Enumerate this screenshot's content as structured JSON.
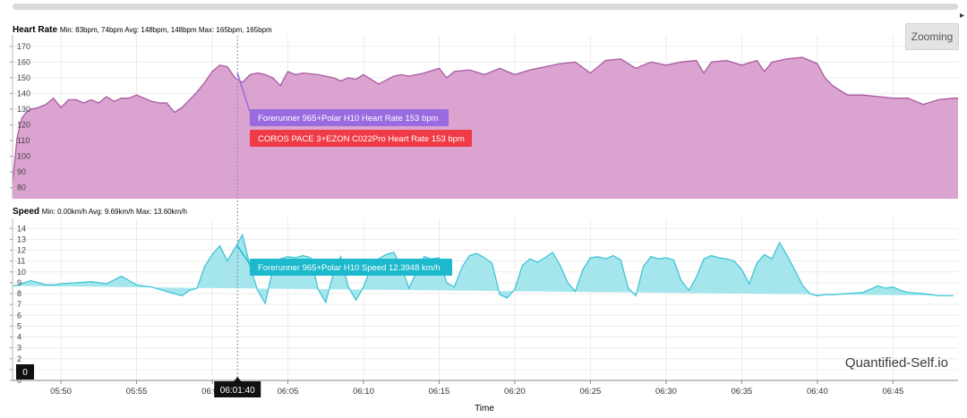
{
  "panel_hr": {
    "label": "Heart Rate",
    "stats": "Min: 83bpm, 74bpm Avg: 148bpm, 148bpm Max: 165bpm, 165bpm"
  },
  "panel_speed": {
    "label": "Speed",
    "stats": "Min: 0.00km/h Avg: 9.69km/h Max: 13.60km/h"
  },
  "zoom_label": "Zooming",
  "watermark": "Quantified-Self.io",
  "cursor_time": "06:01:40",
  "speed_cursor_value": "0",
  "x_title": "Time",
  "colors": {
    "hr_fill": "#dba3cf",
    "hr_line": "#a85aa0",
    "speed_fill": "#a5e6ed",
    "speed_line": "#3fc5d6",
    "tooltip_garmin": "#9a6ae0",
    "tooltip_coros": "#ef3b45",
    "tooltip_speed": "#1cb9cc"
  },
  "chart_data": [
    {
      "type": "area",
      "title": "Heart Rate",
      "y_ticks": [
        80,
        90,
        100,
        110,
        120,
        130,
        140,
        150,
        160,
        170
      ],
      "ylim": [
        73,
        175
      ],
      "x_ticks": [
        "05:50",
        "05:55",
        "06:00",
        "06:05",
        "06:10",
        "06:15",
        "06:20",
        "06:25",
        "06:30",
        "06:35",
        "06:40",
        "06:45"
      ],
      "x_range_minutes": [
        -13.2,
        49.3
      ],
      "series": [
        {
          "name": "Forerunner 965+Polar H10 Heart Rate",
          "x_minutes": [
            -13.2,
            -12.9,
            -12.6,
            -12.3,
            -12.0,
            -11.5,
            -11.0,
            -10.5,
            -10.0,
            -9.5,
            -9.0,
            -8.5,
            -8.0,
            -7.5,
            -7.0,
            -6.5,
            -6.0,
            -5.5,
            -5.0,
            -4.5,
            -4.0,
            -3.5,
            -3.0,
            -2.5,
            -2.0,
            -1.5,
            -1.0,
            -0.5,
            0.0,
            0.5,
            1.0,
            1.5,
            2.0,
            2.5,
            3.0,
            3.5,
            4.0,
            4.5,
            5.0,
            5.5,
            6.0,
            7.0,
            8.0,
            8.5,
            9.0,
            9.5,
            10.0,
            11.0,
            12.0,
            12.5,
            13.0,
            14.0,
            15.0,
            15.5,
            16.0,
            17.0,
            18.0,
            19.0,
            20.0,
            21.0,
            22.0,
            23.0,
            24.0,
            25.0,
            26.0,
            27.0,
            28.0,
            29.0,
            30.0,
            31.0,
            32.0,
            32.5,
            33.0,
            34.0,
            35.0,
            36.0,
            36.5,
            37.0,
            38.0,
            39.0,
            40.0,
            40.5,
            41.0,
            41.5,
            42.0,
            43.0,
            44.0,
            45.0,
            46.0,
            47.0,
            48.0,
            49.0,
            49.3
          ],
          "values": [
            83,
            112,
            124,
            128,
            130,
            131,
            133,
            137,
            131,
            136,
            136,
            134,
            136,
            134,
            138,
            135,
            137,
            137,
            139,
            137,
            135,
            134,
            134,
            128,
            131,
            136,
            141,
            147,
            154,
            158,
            157,
            150,
            147,
            152,
            153,
            152,
            150,
            145,
            154,
            152,
            153,
            152,
            150,
            148,
            150,
            149,
            152,
            146,
            151,
            152,
            151,
            153,
            156,
            150,
            154,
            155,
            152,
            156,
            152,
            155,
            157,
            159,
            160,
            153,
            161,
            162,
            156,
            160,
            158,
            160,
            161,
            153,
            160,
            161,
            158,
            161,
            154,
            160,
            162,
            163,
            159,
            150,
            145,
            142,
            139,
            139,
            138,
            137,
            137,
            133,
            136,
            137,
            137
          ]
        },
        {
          "name": "COROS PACE 3+EZON C022Pro Heart Rate",
          "x_minutes": [],
          "values": []
        }
      ]
    },
    {
      "type": "area",
      "title": "Speed",
      "y_ticks": [
        0,
        1,
        2,
        3,
        4,
        5,
        6,
        7,
        8,
        9,
        10,
        11,
        12,
        13,
        14
      ],
      "ylim": [
        0,
        14.6
      ],
      "x_ticks": [
        "05:50",
        "05:55",
        "06:00",
        "06:05",
        "06:10",
        "06:15",
        "06:20",
        "06:25",
        "06:30",
        "06:35",
        "06:40",
        "06:45"
      ],
      "x_range_minutes": [
        -13.2,
        49.3
      ],
      "series": [
        {
          "name": "Forerunner 965+Polar H10 Speed",
          "x_minutes": [
            -13.2,
            -12.8,
            -12.4,
            -12.0,
            -11.5,
            -11.0,
            -10.5,
            -10.0,
            -9.0,
            -8.0,
            -7.0,
            -6.0,
            -5.5,
            -5.0,
            -4.5,
            -4.0,
            -3.0,
            -2.0,
            -1.5,
            -1.0,
            -0.5,
            0.0,
            0.5,
            1.0,
            1.5,
            2.0,
            2.5,
            3.0,
            3.5,
            4.0,
            4.5,
            5.0,
            5.5,
            6.0,
            6.5,
            7.0,
            7.5,
            8.0,
            8.5,
            9.0,
            9.5,
            10.0,
            10.5,
            11.0,
            11.5,
            12.0,
            12.5,
            13.0,
            13.5,
            14.0,
            14.5,
            15.0,
            15.5,
            16.0,
            16.5,
            17.0,
            17.5,
            18.0,
            18.5,
            19.0,
            19.5,
            20.0,
            20.5,
            21.0,
            21.5,
            22.0,
            22.5,
            23.0,
            23.5,
            24.0,
            24.5,
            25.0,
            25.5,
            26.0,
            26.5,
            27.0,
            27.5,
            28.0,
            28.5,
            29.0,
            29.5,
            30.0,
            30.5,
            31.0,
            31.5,
            32.0,
            32.5,
            33.0,
            33.5,
            34.0,
            34.5,
            35.0,
            35.5,
            36.0,
            36.5,
            37.0,
            37.5,
            38.0,
            38.5,
            39.0,
            39.5,
            40.0,
            40.5,
            41.0,
            42.0,
            43.0,
            44.0,
            44.5,
            45.0,
            45.5,
            46.0,
            47.0,
            48.0,
            49.0,
            49.3
          ],
          "values": [
            8.7,
            8.8,
            9.0,
            9.2,
            9.0,
            8.8,
            8.8,
            8.9,
            9.0,
            9.1,
            8.9,
            9.6,
            9.2,
            8.8,
            8.7,
            8.6,
            8.2,
            7.8,
            8.3,
            8.5,
            10.5,
            11.6,
            12.4,
            11.0,
            12.2,
            13.4,
            10.5,
            8.3,
            7.1,
            10.2,
            11.2,
            11.4,
            11.3,
            11.5,
            11.3,
            8.4,
            7.2,
            9.8,
            11.4,
            8.6,
            7.4,
            8.6,
            10.5,
            11.2,
            11.6,
            11.8,
            10.5,
            8.5,
            10.0,
            11.4,
            11.2,
            11.3,
            9.0,
            8.6,
            10.4,
            11.5,
            11.7,
            11.3,
            10.8,
            7.9,
            7.6,
            8.4,
            10.6,
            11.2,
            10.9,
            11.3,
            11.8,
            10.6,
            9.0,
            8.2,
            10.2,
            11.3,
            11.4,
            11.2,
            11.5,
            11.1,
            8.5,
            7.8,
            10.5,
            11.4,
            11.2,
            11.3,
            11.1,
            9.2,
            8.3,
            9.5,
            11.2,
            11.5,
            11.3,
            11.2,
            11.0,
            10.2,
            8.9,
            10.8,
            11.6,
            11.2,
            12.7,
            11.5,
            10.2,
            8.8,
            8.0,
            7.8,
            7.9,
            7.9,
            8.0,
            8.1,
            8.7,
            8.5,
            8.6,
            8.3,
            8.1,
            8.0,
            7.8,
            7.8
          ]
        }
      ]
    }
  ],
  "tooltips": {
    "hr_garmin": "Forerunner 965+Polar H10 Heart Rate 153 bpm",
    "hr_coros": "COROS PACE 3+EZON C022Pro Heart Rate 153 bpm",
    "speed": "Forerunner 965+Polar H10 Speed 12.3948 km/h"
  },
  "cursor_minutes": 1.67
}
